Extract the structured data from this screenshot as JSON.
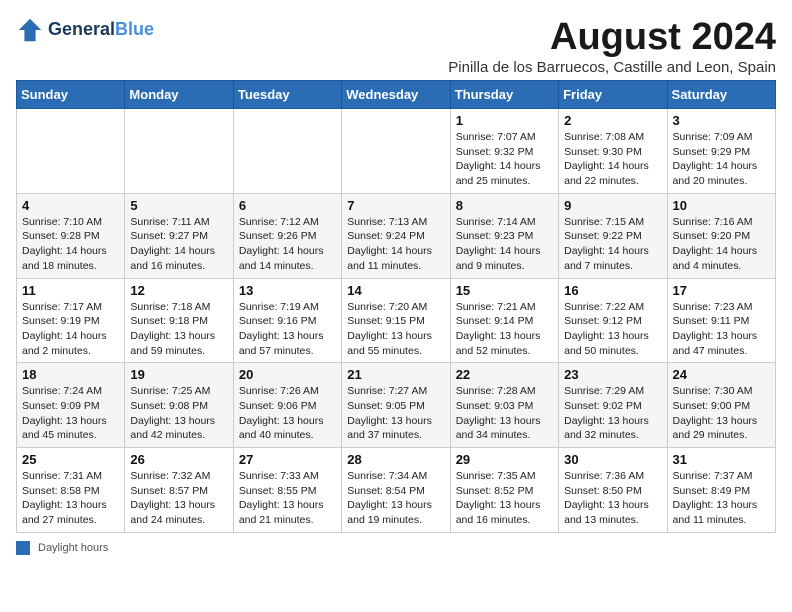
{
  "header": {
    "logo_line1": "General",
    "logo_line2": "Blue",
    "title": "August 2024",
    "subtitle": "Pinilla de los Barruecos, Castille and Leon, Spain"
  },
  "days_of_week": [
    "Sunday",
    "Monday",
    "Tuesday",
    "Wednesday",
    "Thursday",
    "Friday",
    "Saturday"
  ],
  "weeks": [
    [
      {
        "day": "",
        "info": ""
      },
      {
        "day": "",
        "info": ""
      },
      {
        "day": "",
        "info": ""
      },
      {
        "day": "",
        "info": ""
      },
      {
        "day": "1",
        "info": "Sunrise: 7:07 AM\nSunset: 9:32 PM\nDaylight: 14 hours and 25 minutes."
      },
      {
        "day": "2",
        "info": "Sunrise: 7:08 AM\nSunset: 9:30 PM\nDaylight: 14 hours and 22 minutes."
      },
      {
        "day": "3",
        "info": "Sunrise: 7:09 AM\nSunset: 9:29 PM\nDaylight: 14 hours and 20 minutes."
      }
    ],
    [
      {
        "day": "4",
        "info": "Sunrise: 7:10 AM\nSunset: 9:28 PM\nDaylight: 14 hours and 18 minutes."
      },
      {
        "day": "5",
        "info": "Sunrise: 7:11 AM\nSunset: 9:27 PM\nDaylight: 14 hours and 16 minutes."
      },
      {
        "day": "6",
        "info": "Sunrise: 7:12 AM\nSunset: 9:26 PM\nDaylight: 14 hours and 14 minutes."
      },
      {
        "day": "7",
        "info": "Sunrise: 7:13 AM\nSunset: 9:24 PM\nDaylight: 14 hours and 11 minutes."
      },
      {
        "day": "8",
        "info": "Sunrise: 7:14 AM\nSunset: 9:23 PM\nDaylight: 14 hours and 9 minutes."
      },
      {
        "day": "9",
        "info": "Sunrise: 7:15 AM\nSunset: 9:22 PM\nDaylight: 14 hours and 7 minutes."
      },
      {
        "day": "10",
        "info": "Sunrise: 7:16 AM\nSunset: 9:20 PM\nDaylight: 14 hours and 4 minutes."
      }
    ],
    [
      {
        "day": "11",
        "info": "Sunrise: 7:17 AM\nSunset: 9:19 PM\nDaylight: 14 hours and 2 minutes."
      },
      {
        "day": "12",
        "info": "Sunrise: 7:18 AM\nSunset: 9:18 PM\nDaylight: 13 hours and 59 minutes."
      },
      {
        "day": "13",
        "info": "Sunrise: 7:19 AM\nSunset: 9:16 PM\nDaylight: 13 hours and 57 minutes."
      },
      {
        "day": "14",
        "info": "Sunrise: 7:20 AM\nSunset: 9:15 PM\nDaylight: 13 hours and 55 minutes."
      },
      {
        "day": "15",
        "info": "Sunrise: 7:21 AM\nSunset: 9:14 PM\nDaylight: 13 hours and 52 minutes."
      },
      {
        "day": "16",
        "info": "Sunrise: 7:22 AM\nSunset: 9:12 PM\nDaylight: 13 hours and 50 minutes."
      },
      {
        "day": "17",
        "info": "Sunrise: 7:23 AM\nSunset: 9:11 PM\nDaylight: 13 hours and 47 minutes."
      }
    ],
    [
      {
        "day": "18",
        "info": "Sunrise: 7:24 AM\nSunset: 9:09 PM\nDaylight: 13 hours and 45 minutes."
      },
      {
        "day": "19",
        "info": "Sunrise: 7:25 AM\nSunset: 9:08 PM\nDaylight: 13 hours and 42 minutes."
      },
      {
        "day": "20",
        "info": "Sunrise: 7:26 AM\nSunset: 9:06 PM\nDaylight: 13 hours and 40 minutes."
      },
      {
        "day": "21",
        "info": "Sunrise: 7:27 AM\nSunset: 9:05 PM\nDaylight: 13 hours and 37 minutes."
      },
      {
        "day": "22",
        "info": "Sunrise: 7:28 AM\nSunset: 9:03 PM\nDaylight: 13 hours and 34 minutes."
      },
      {
        "day": "23",
        "info": "Sunrise: 7:29 AM\nSunset: 9:02 PM\nDaylight: 13 hours and 32 minutes."
      },
      {
        "day": "24",
        "info": "Sunrise: 7:30 AM\nSunset: 9:00 PM\nDaylight: 13 hours and 29 minutes."
      }
    ],
    [
      {
        "day": "25",
        "info": "Sunrise: 7:31 AM\nSunset: 8:58 PM\nDaylight: 13 hours and 27 minutes."
      },
      {
        "day": "26",
        "info": "Sunrise: 7:32 AM\nSunset: 8:57 PM\nDaylight: 13 hours and 24 minutes."
      },
      {
        "day": "27",
        "info": "Sunrise: 7:33 AM\nSunset: 8:55 PM\nDaylight: 13 hours and 21 minutes."
      },
      {
        "day": "28",
        "info": "Sunrise: 7:34 AM\nSunset: 8:54 PM\nDaylight: 13 hours and 19 minutes."
      },
      {
        "day": "29",
        "info": "Sunrise: 7:35 AM\nSunset: 8:52 PM\nDaylight: 13 hours and 16 minutes."
      },
      {
        "day": "30",
        "info": "Sunrise: 7:36 AM\nSunset: 8:50 PM\nDaylight: 13 hours and 13 minutes."
      },
      {
        "day": "31",
        "info": "Sunrise: 7:37 AM\nSunset: 8:49 PM\nDaylight: 13 hours and 11 minutes."
      }
    ]
  ],
  "footer": {
    "swatch_label": "Daylight hours"
  }
}
